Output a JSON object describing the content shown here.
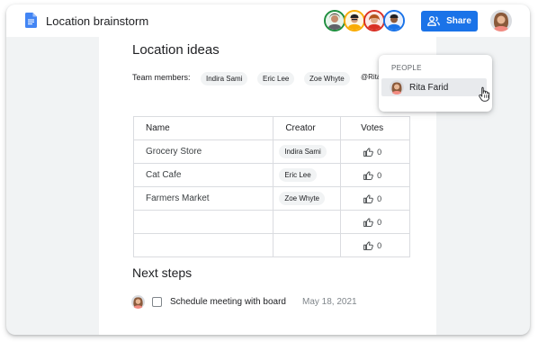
{
  "doc": {
    "title": "Location brainstorm",
    "icon": "docs-icon",
    "accent_color": "#1a73e8"
  },
  "toolbar": {
    "collaborators": [
      {
        "icon": "collaborator-avatar",
        "ring_color": "#1e8e3e"
      },
      {
        "icon": "collaborator-avatar",
        "ring_color": "#f9ab00"
      },
      {
        "icon": "collaborator-avatar",
        "ring_color": "#d93025"
      },
      {
        "icon": "collaborator-avatar",
        "ring_color": "#1a73e8"
      }
    ],
    "share_label": "Share",
    "share_icon": "add-people-icon"
  },
  "page": {
    "heading": "Location ideas",
    "team_label": "Team members:",
    "team_members": [
      "Indira Sami",
      "Eric Lee",
      "Zoe Whyte"
    ],
    "mention_text": "@Rita",
    "table": {
      "headers": [
        "Name",
        "Creator",
        "Votes"
      ],
      "rows": [
        {
          "name": "Grocery Store",
          "creator": "Indira Sami",
          "votes": "0"
        },
        {
          "name": "Cat Cafe",
          "creator": "Eric Lee",
          "votes": "0"
        },
        {
          "name": "Farmers Market",
          "creator": "Zoe Whyte",
          "votes": "0"
        },
        {
          "name": "",
          "creator": "",
          "votes": "0"
        },
        {
          "name": "",
          "creator": "",
          "votes": "0"
        }
      ]
    },
    "next_heading": "Next steps",
    "task": {
      "text": "Schedule meeting with board",
      "date": "May 18, 2021",
      "checked": false
    }
  },
  "people_popup": {
    "header": "PEOPLE",
    "items": [
      {
        "name": "Rita Farid",
        "icon": "person-avatar"
      }
    ]
  }
}
